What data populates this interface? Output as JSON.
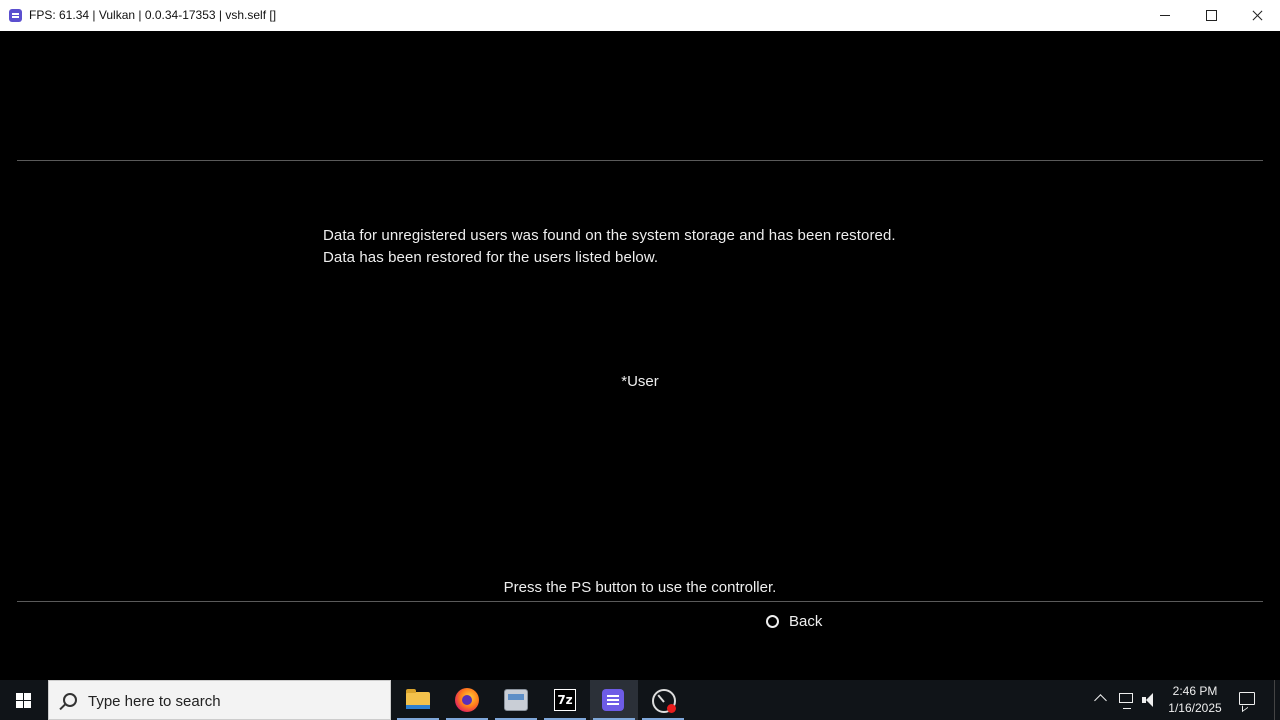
{
  "window": {
    "title": "FPS: 61.34 | Vulkan | 0.0.34-17353 | vsh.self []",
    "app_icon": "rpcs3-icon",
    "controls": [
      "minimize-icon",
      "maximize-icon",
      "close-icon"
    ]
  },
  "dialog": {
    "message_line1": "Data for unregistered users was found on the system storage and has been restored.",
    "message_line2": "Data has been restored for the users listed below.",
    "restored_user": "*User",
    "controller_hint": "Press the PS button to use the controller.",
    "back_label": "Back",
    "back_icon": "circle-button-icon"
  },
  "taskbar": {
    "start_icon": "windows-logo-icon",
    "search_placeholder": "Type here to search",
    "apps": [
      "file-explorer-icon",
      "firefox-icon",
      "scanner-icon",
      "7zip-icon",
      "rpcs3-icon",
      "debug-app-icon"
    ],
    "sevenzip_label": "7z",
    "clock_time": "2:46 PM",
    "clock_date": "1/16/2025"
  },
  "colors": {
    "screen_bg": "#000000",
    "taskbar_bg": "#101418",
    "text": "#eeeeee",
    "accent": "#6e5ce6"
  }
}
